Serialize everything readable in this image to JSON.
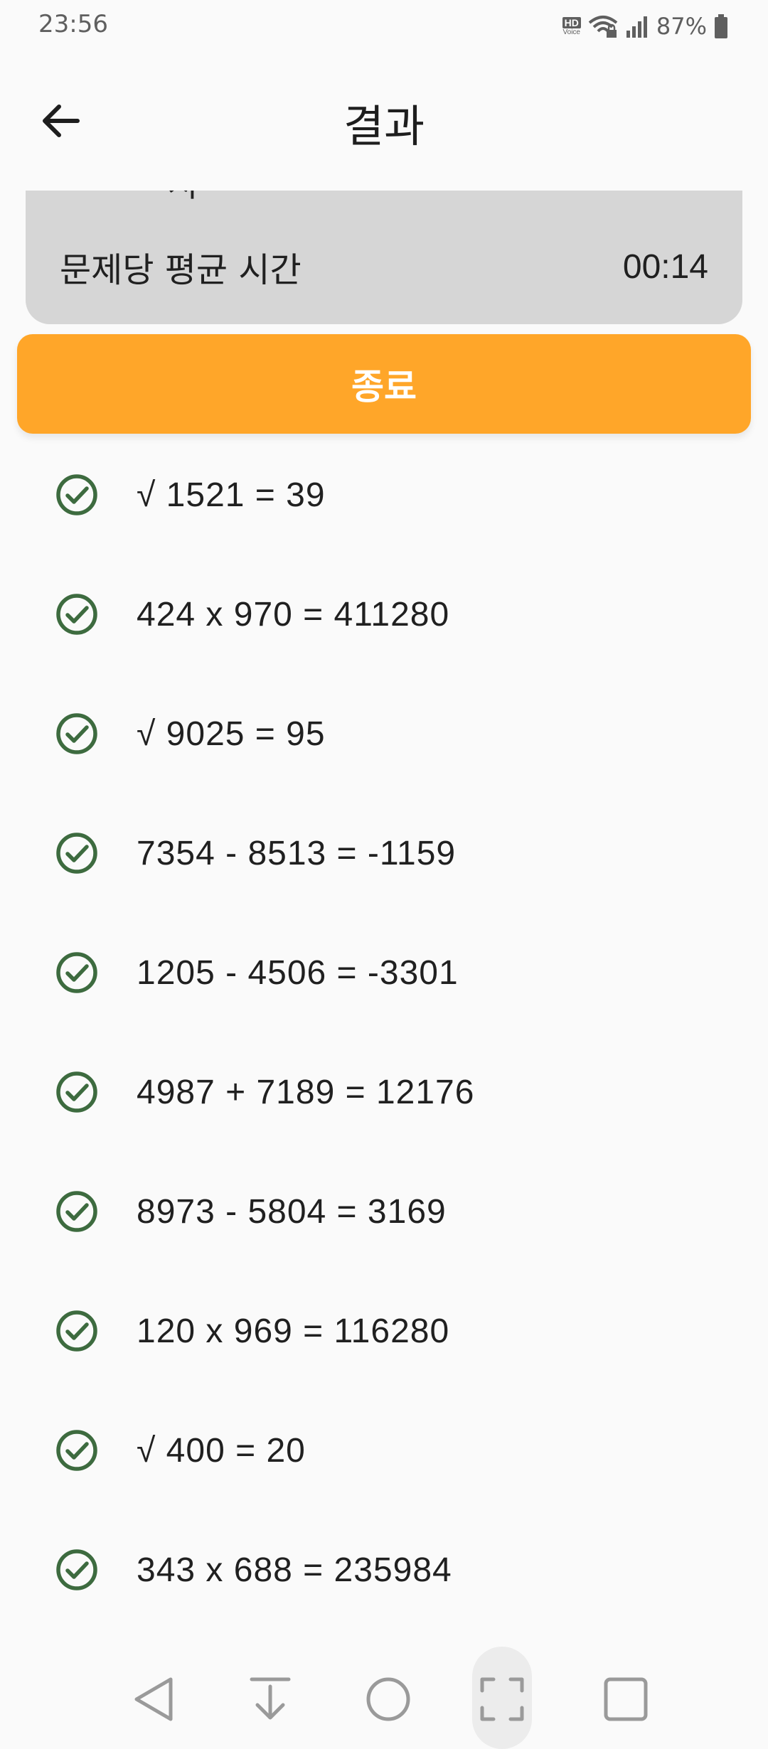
{
  "status_bar": {
    "time": "23:56",
    "hd_label": "HD",
    "voice_label": "Voice",
    "battery": "87%"
  },
  "app_bar": {
    "title": "결과"
  },
  "summary": {
    "partial_text": "시간",
    "avg_time_label": "문제당 평균 시간",
    "avg_time_value": "00:14"
  },
  "end_button": {
    "label": "종료"
  },
  "results": [
    {
      "text": "√ 1521 = 39",
      "correct": true
    },
    {
      "text": "424 x 970 = 411280",
      "correct": true
    },
    {
      "text": "√ 9025 = 95",
      "correct": true
    },
    {
      "text": "7354 - 8513 = -1159",
      "correct": true
    },
    {
      "text": "1205 - 4506 = -3301",
      "correct": true
    },
    {
      "text": "4987 + 7189 = 12176",
      "correct": true
    },
    {
      "text": "8973 - 5804 = 3169",
      "correct": true
    },
    {
      "text": "120 x 969 = 116280",
      "correct": true
    },
    {
      "text": "√ 400 = 20",
      "correct": true
    },
    {
      "text": "343 x 688 = 235984",
      "correct": true
    }
  ],
  "colors": {
    "accent": "#ffa629",
    "check": "#3d6b3f",
    "card": "#d6d6d6"
  },
  "nav_icons": [
    "back-triangle-icon",
    "download-arrow-icon",
    "home-circle-icon",
    "screenshot-frame-icon",
    "recents-square-icon"
  ]
}
